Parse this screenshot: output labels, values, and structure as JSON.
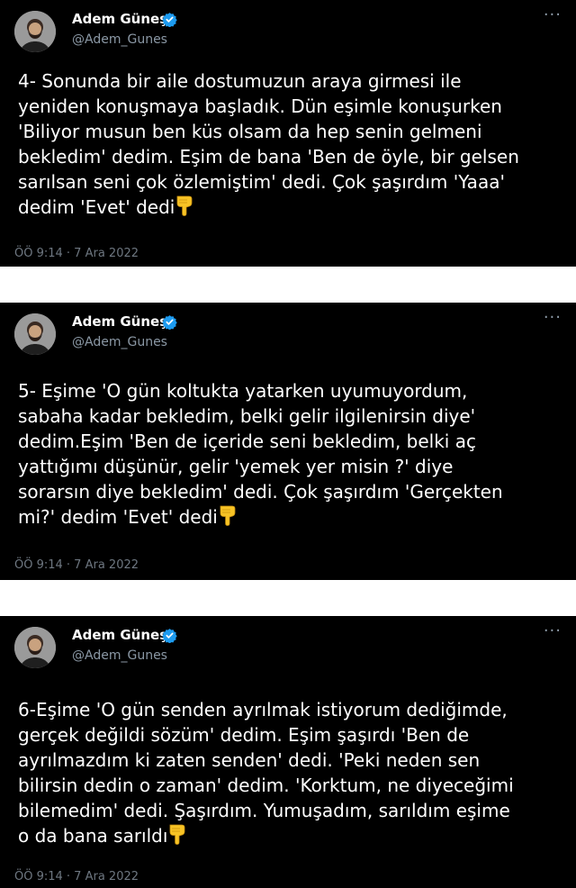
{
  "tweets": [
    {
      "author": "Adem Güneş",
      "handle": "@Adem_Gunes",
      "more": "···",
      "text": "4- Sonunda bir aile dostumuzun araya girmesi ile\nyeniden konuşmaya başladık. Dün eşimle konuşurken\n'Biliyor musun ben küs olsam da hep senin gelmeni\nbekledim' dedim. Eşim de bana 'Ben de öyle, bir gelsen\nsarılsan seni çok özlemiştim' dedi. Çok şaşırdım 'Yaaa'\ndedim 'Evet' dedi",
      "timestamp": "ÖÖ 9:14 · 7 Ara 2022"
    },
    {
      "author": "Adem Güneş",
      "handle": "@Adem_Gunes",
      "more": "···",
      "text": "5- Eşime 'O gün koltukta yatarken uyumuyordum,\nsabaha kadar bekledim, belki gelir ilgilenirsin diye'\ndedim.Eşim 'Ben de içeride seni bekledim, belki aç\nyattığımı düşünür, gelir 'yemek yer misin ?' diye\nsorarsın diye bekledim' dedi. Çok şaşırdım 'Gerçekten\nmi?' dedim 'Evet' dedi",
      "timestamp": "ÖÖ 9:14 · 7 Ara 2022"
    },
    {
      "author": "Adem Güneş",
      "handle": "@Adem_Gunes",
      "more": "···",
      "text": "6-Eşime 'O gün senden ayrılmak istiyorum dediğimde,\ngerçek değildi sözüm' dedim. Eşim şaşırdı 'Ben de\nayrılmazdım ki zaten senden' dedi. 'Peki neden sen\nbilirsin dedin o zaman' dedim. 'Korktum, ne diyeceğimi\nbilemedim' dedi. Şaşırdım. Yumuşadım, sarıldım eşime\no da bana sarıldı",
      "timestamp": "ÖÖ 9:14 · 7 Ara 2022"
    }
  ],
  "icons": {
    "verified": "verified-badge-icon",
    "emoji": "backhand-index-pointing-down-emoji"
  },
  "colors": {
    "background": "#000000",
    "text": "#ffffff",
    "secondary": "#8b98a5",
    "verified": "#1d9bf0",
    "emoji": "#f7c325"
  }
}
